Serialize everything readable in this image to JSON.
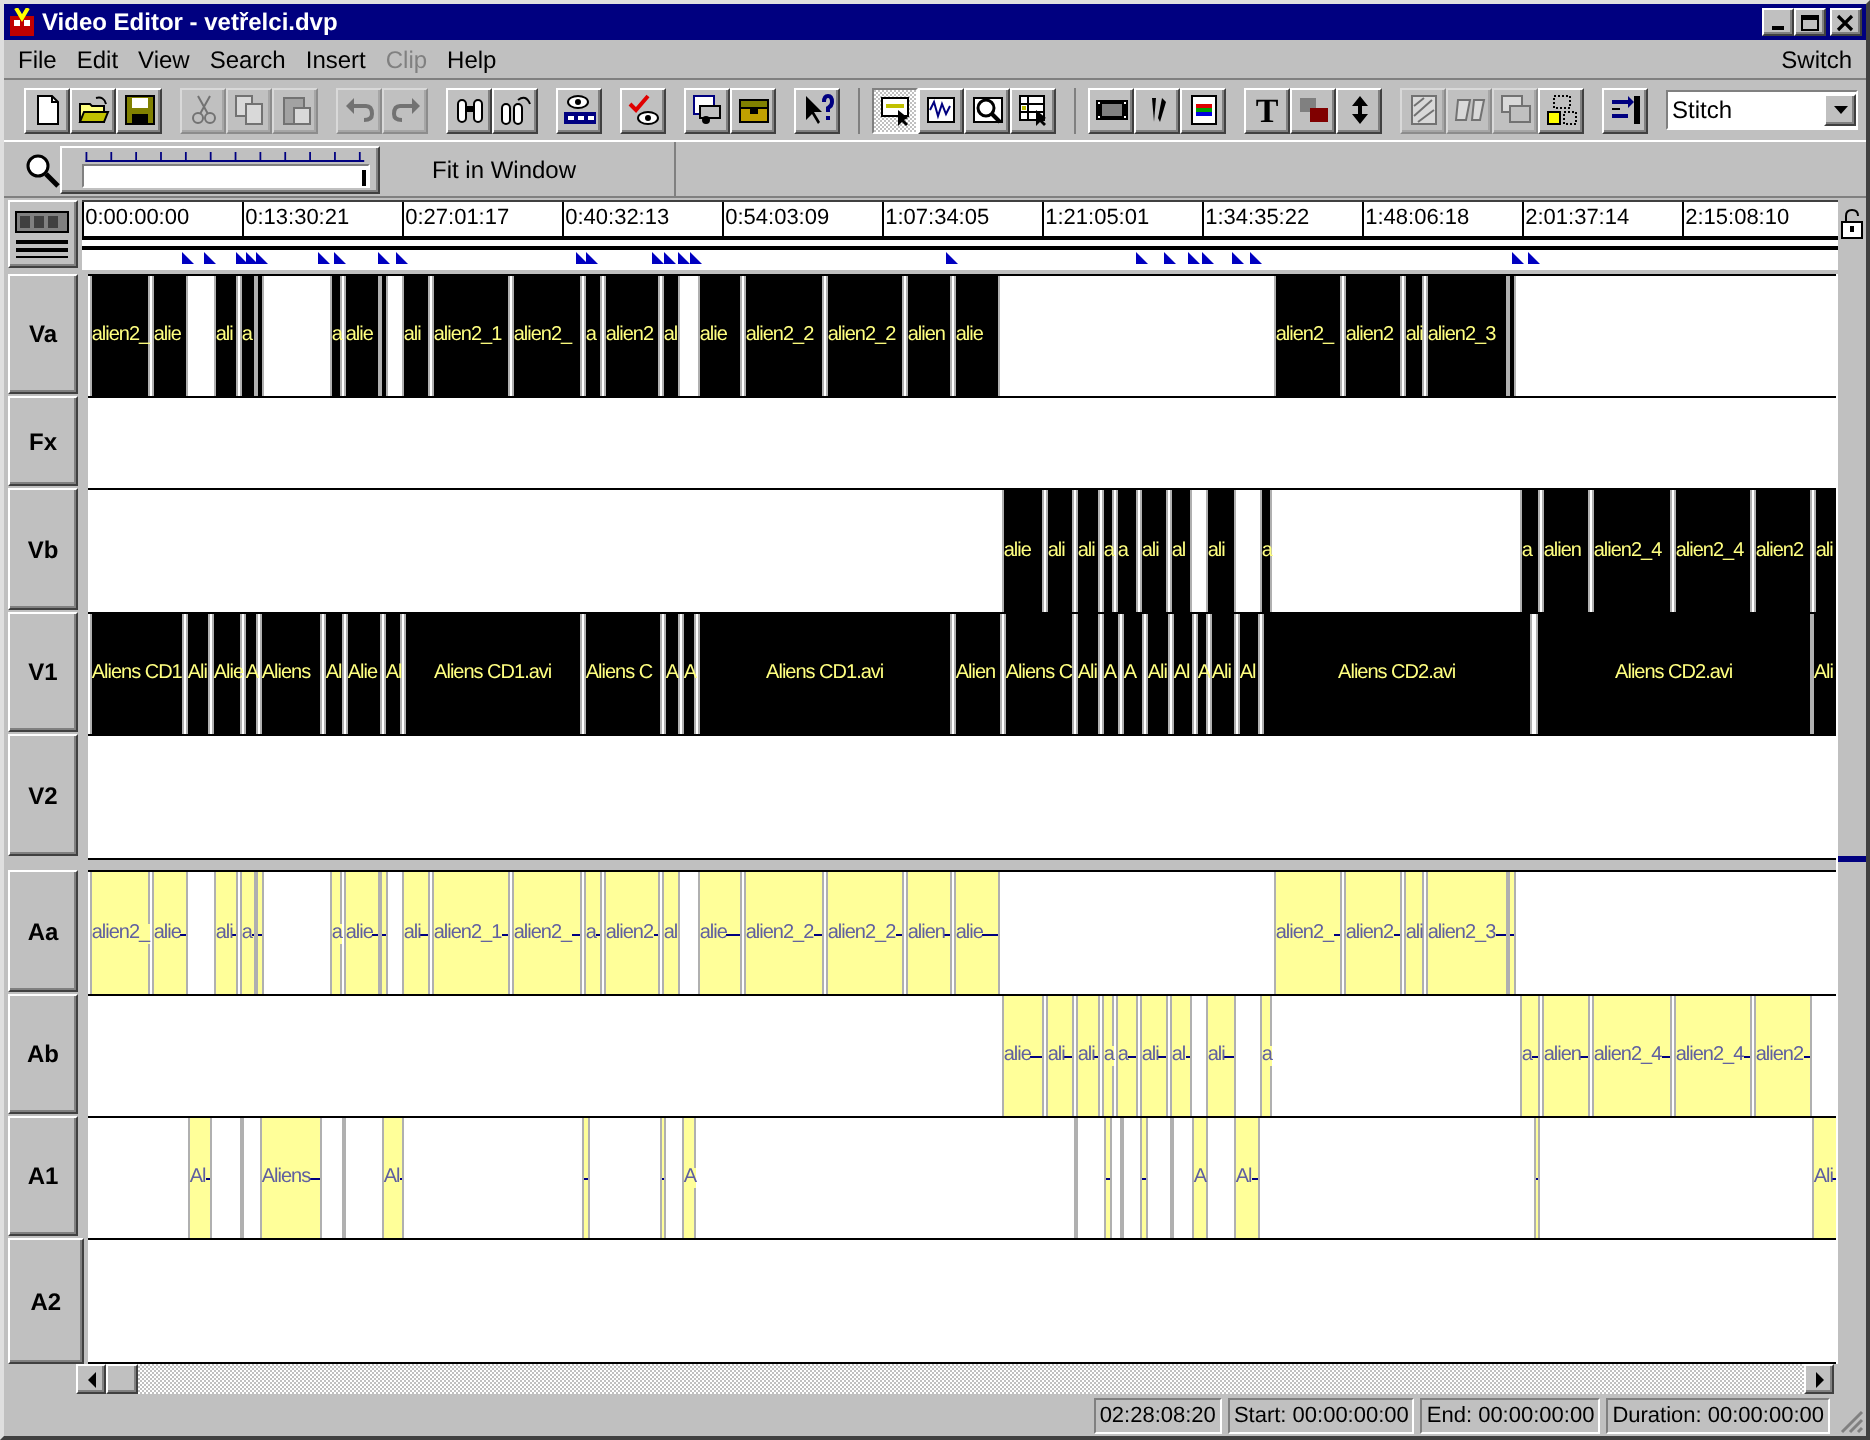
{
  "window": {
    "title": "Video Editor - vetřelci.dvp"
  },
  "menu": [
    {
      "label": "File",
      "disabled": false
    },
    {
      "label": "Edit",
      "disabled": false
    },
    {
      "label": "View",
      "disabled": false
    },
    {
      "label": "Search",
      "disabled": false
    },
    {
      "label": "Insert",
      "disabled": false
    },
    {
      "label": "Clip",
      "disabled": true
    },
    {
      "label": "Help",
      "disabled": false
    }
  ],
  "menu_right": {
    "label": "Switch"
  },
  "toolbar": {
    "groups": [
      [
        {
          "disabled": false,
          "pressed": false
        },
        {
          "disabled": false,
          "pressed": false
        },
        {
          "disabled": false,
          "pressed": false
        }
      ],
      [
        {
          "disabled": true,
          "pressed": false
        },
        {
          "disabled": true,
          "pressed": false
        },
        {
          "disabled": true,
          "pressed": false
        }
      ],
      [
        {
          "disabled": true,
          "pressed": false
        },
        {
          "disabled": true,
          "pressed": false
        }
      ],
      [
        {
          "disabled": false,
          "pressed": false
        },
        {
          "disabled": false,
          "pressed": false
        }
      ],
      [
        {
          "disabled": false,
          "pressed": false
        }
      ],
      [
        {
          "disabled": false,
          "pressed": false
        }
      ],
      [
        {
          "disabled": false,
          "pressed": false
        },
        {
          "disabled": false,
          "pressed": false
        }
      ],
      [
        {
          "disabled": false,
          "pressed": false
        }
      ],
      [
        {
          "disabled": false,
          "pressed": true
        },
        {
          "disabled": false,
          "pressed": false
        },
        {
          "disabled": false,
          "pressed": false
        },
        {
          "disabled": false,
          "pressed": false
        }
      ],
      [
        {
          "disabled": false,
          "pressed": false
        },
        {
          "disabled": false,
          "pressed": false
        },
        {
          "disabled": false,
          "pressed": false
        }
      ],
      [
        {
          "disabled": false,
          "pressed": false,
          "glyph": "T"
        },
        {
          "disabled": false,
          "pressed": false
        },
        {
          "disabled": false,
          "pressed": false
        }
      ],
      [
        {
          "disabled": true,
          "pressed": false
        },
        {
          "disabled": true,
          "pressed": false
        },
        {
          "disabled": true,
          "pressed": false
        },
        {
          "disabled": false,
          "pressed": false
        }
      ],
      [
        {
          "disabled": false,
          "pressed": false
        }
      ]
    ]
  },
  "mode_dropdown": {
    "value": "Stitch"
  },
  "zoom": {
    "level": 1,
    "label": "Fit in Window"
  },
  "ruler": [
    "0:00:00:00",
    "0:13:30:21",
    "0:27:01:17",
    "0:40:32:13",
    "0:54:03:09",
    "1:07:34:05",
    "1:21:05:01",
    "1:34:35:22",
    "1:48:06:18",
    "2:01:37:14",
    "2:15:08:10"
  ],
  "tracks": [
    {
      "name": "Va",
      "kind": "video",
      "clips": [
        {
          "label": "alien2_"
        },
        {
          "label": "alie"
        },
        {
          "label": "ali"
        },
        {
          "label": "a"
        },
        {
          "label": "a"
        },
        {
          "label": "alie"
        },
        {
          "label": "ali"
        },
        {
          "label": "alien2_1"
        },
        {
          "label": "alien2_"
        },
        {
          "label": "a"
        },
        {
          "label": "alien2"
        },
        {
          "label": "al"
        },
        {
          "label": "alie"
        },
        {
          "label": "alien2_2"
        },
        {
          "label": "alien2_2"
        },
        {
          "label": "alien"
        },
        {
          "label": "alie"
        },
        {
          "label": "alien2_"
        },
        {
          "label": "alien2"
        },
        {
          "label": "ali"
        },
        {
          "label": "alien2_3"
        }
      ]
    },
    {
      "name": "Fx",
      "kind": "effects"
    },
    {
      "name": "Vb",
      "kind": "video",
      "clips": [
        {
          "label": "alie"
        },
        {
          "label": "ali"
        },
        {
          "label": "ali"
        },
        {
          "label": "a"
        },
        {
          "label": "a"
        },
        {
          "label": "ali"
        },
        {
          "label": "al"
        },
        {
          "label": "ali"
        },
        {
          "label": "a"
        },
        {
          "label": "a"
        },
        {
          "label": "alien"
        },
        {
          "label": "alien2_4"
        },
        {
          "label": "alien2_4"
        },
        {
          "label": "alien2"
        },
        {
          "label": "ali"
        }
      ]
    },
    {
      "name": "V1",
      "kind": "video",
      "clips": [
        {
          "label": "Aliens CD1"
        },
        {
          "label": "Ali"
        },
        {
          "label": "Alie"
        },
        {
          "label": "A"
        },
        {
          "label": "Aliens"
        },
        {
          "label": "Al"
        },
        {
          "label": "Alie"
        },
        {
          "label": "Al"
        },
        {
          "label": "Aliens CD1.avi"
        },
        {
          "label": "Aliens C"
        },
        {
          "label": "A"
        },
        {
          "label": "A"
        },
        {
          "label": "Aliens CD1.avi"
        },
        {
          "label": "Alien"
        },
        {
          "label": "Aliens C"
        },
        {
          "label": "Ali"
        },
        {
          "label": "A"
        },
        {
          "label": "A"
        },
        {
          "label": "Ali"
        },
        {
          "label": "Al"
        },
        {
          "label": "A"
        },
        {
          "label": "Ali"
        },
        {
          "label": "Al"
        },
        {
          "label": "Aliens CD2.avi"
        },
        {
          "label": "Aliens CD2.avi"
        },
        {
          "label": "Ali"
        }
      ]
    },
    {
      "name": "V2",
      "kind": "video"
    },
    {
      "name": "Aa",
      "kind": "audio",
      "clips": [
        {
          "label": "alien2_"
        },
        {
          "label": "alie"
        },
        {
          "label": "ali"
        },
        {
          "label": "a"
        },
        {
          "label": "a"
        },
        {
          "label": "alie"
        },
        {
          "label": "ali"
        },
        {
          "label": "alien2_1"
        },
        {
          "label": "alien2_"
        },
        {
          "label": "a"
        },
        {
          "label": "alien2"
        },
        {
          "label": "al"
        },
        {
          "label": "alie"
        },
        {
          "label": "alien2_2"
        },
        {
          "label": "alien2_2"
        },
        {
          "label": "alien"
        },
        {
          "label": "alie"
        },
        {
          "label": "alien2_"
        },
        {
          "label": "alien2"
        },
        {
          "label": "ali"
        },
        {
          "label": "alien2_3"
        }
      ]
    },
    {
      "name": "Ab",
      "kind": "audio",
      "clips": [
        {
          "label": "alie"
        },
        {
          "label": "ali"
        },
        {
          "label": "ali"
        },
        {
          "label": "a"
        },
        {
          "label": "a"
        },
        {
          "label": "ali"
        },
        {
          "label": "al"
        },
        {
          "label": "ali"
        },
        {
          "label": "a"
        },
        {
          "label": "a"
        },
        {
          "label": "alien"
        },
        {
          "label": "alien2_4"
        },
        {
          "label": "alien2_4"
        },
        {
          "label": "alien2"
        }
      ]
    },
    {
      "name": "A1",
      "kind": "audio",
      "clips": [
        {
          "label": "Al"
        },
        {
          "label": "Aliens"
        },
        {
          "label": "Al"
        },
        {
          "label": "A"
        },
        {
          "label": "A"
        },
        {
          "label": "Al"
        },
        {
          "label": "Ali"
        }
      ]
    },
    {
      "name": "A2",
      "kind": "audio"
    }
  ],
  "status_bar": [
    "02:28:08:20",
    "Start: 00:00:00:00",
    "End: 00:00:00:00",
    "Duration: 00:00:00:00"
  ]
}
